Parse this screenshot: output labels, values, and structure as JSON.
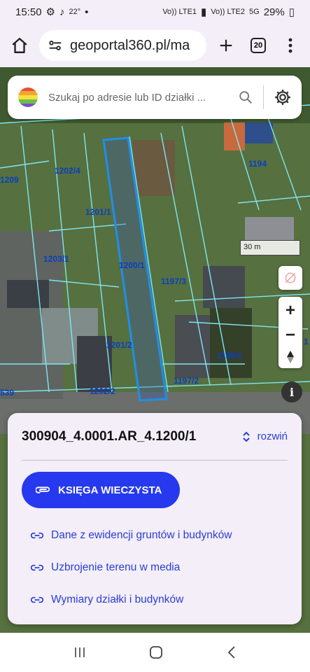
{
  "status": {
    "time": "15:50",
    "temp": "22°",
    "net1": "Vo)) LTE1",
    "net2": "Vo)) LTE2",
    "net5g": "5G",
    "battery": "29%"
  },
  "browser": {
    "url": "geoportal360.pl/ma",
    "tabs": "20"
  },
  "search": {
    "placeholder": "Szukaj po adresie lub ID działki ..."
  },
  "map": {
    "scale": "30 m",
    "parcels": [
      {
        "label": "1209"
      },
      {
        "label": "1202/4"
      },
      {
        "label": "1194"
      },
      {
        "label": "1201/1"
      },
      {
        "label": "1203/1"
      },
      {
        "label": "1200/1"
      },
      {
        "label": "1197/3"
      },
      {
        "label": "1201/2"
      },
      {
        "label": "1196/1"
      },
      {
        "label": "1197/2"
      },
      {
        "label": "1202/2"
      },
      {
        "label": "539"
      },
      {
        "label": "1"
      }
    ]
  },
  "panel": {
    "parcel_id": "300904_4.0001.AR_4.1200/1",
    "expand": "rozwiń",
    "primary_button": "KSIĘGA WIECZYSTA",
    "links": [
      {
        "label": "Dane z ewidencji gruntów i budynków"
      },
      {
        "label": "Uzbrojenie terenu w media"
      },
      {
        "label": "Wymiary działki i budynków"
      }
    ]
  }
}
